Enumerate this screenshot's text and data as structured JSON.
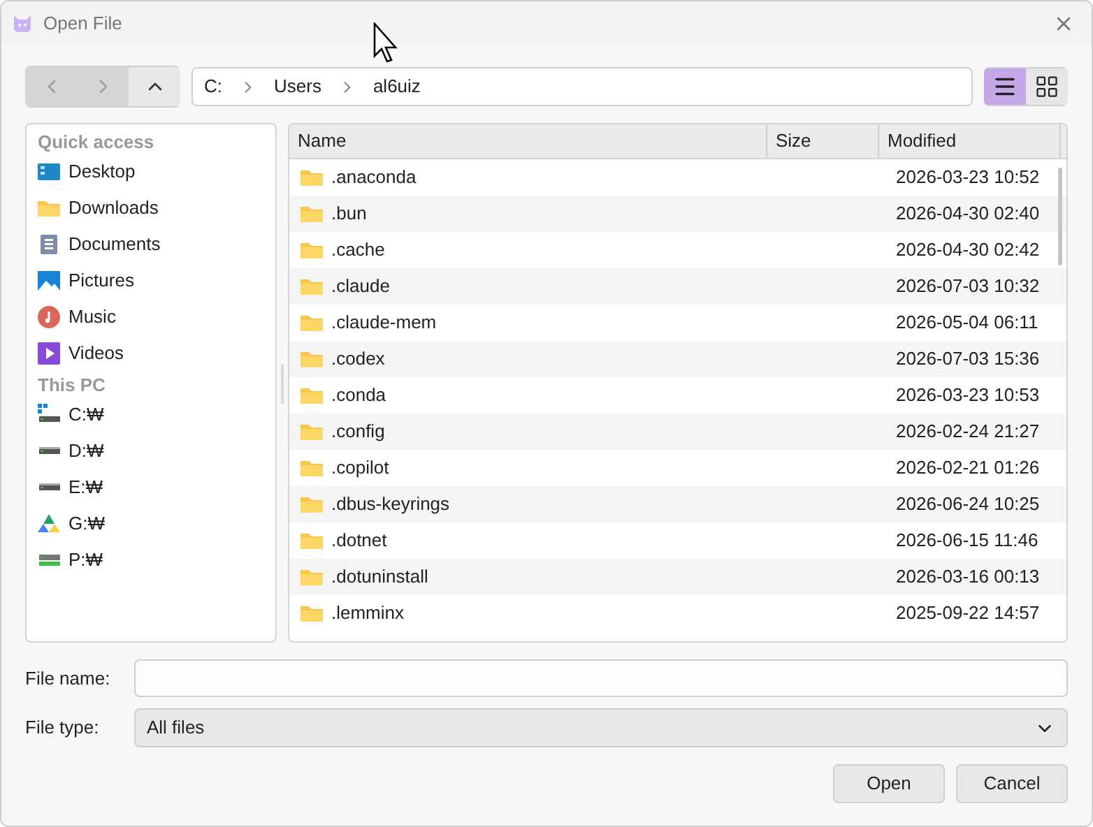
{
  "window": {
    "title": "Open File"
  },
  "nav": {
    "back": {
      "disabled": true
    },
    "forward": {
      "disabled": true
    },
    "up": {
      "disabled": false
    }
  },
  "breadcrumb": [
    "C:",
    "Users",
    "al6uiz"
  ],
  "view_buttons": [
    {
      "kind": "list",
      "selected": true
    },
    {
      "kind": "grid",
      "selected": false
    }
  ],
  "sidebar": {
    "sections": [
      {
        "title": "Quick access",
        "items": [
          {
            "label": "Desktop",
            "kind": "desktop"
          },
          {
            "label": "Downloads",
            "kind": "folder"
          },
          {
            "label": "Documents",
            "kind": "document"
          },
          {
            "label": "Pictures",
            "kind": "pictures"
          },
          {
            "label": "Music",
            "kind": "music"
          },
          {
            "label": "Videos",
            "kind": "videos"
          }
        ]
      },
      {
        "title": "This PC",
        "items": [
          {
            "label": "C:₩",
            "kind": "system-drive"
          },
          {
            "label": "D:₩",
            "kind": "drive"
          },
          {
            "label": "E:₩",
            "kind": "drive"
          },
          {
            "label": "G:₩",
            "kind": "cloud-drive"
          },
          {
            "label": "P:₩",
            "kind": "green-drive"
          }
        ]
      }
    ]
  },
  "table": {
    "columns": [
      "Name",
      "Size",
      "Modified"
    ],
    "rows": [
      {
        "name": ".anaconda",
        "size": "",
        "modified": "2026-03-23 10:52"
      },
      {
        "name": ".bun",
        "modified": "2026-04-30 02:40"
      },
      {
        "name": ".cache",
        "modified": "2026-04-30 02:42"
      },
      {
        "name": ".claude",
        "modified": "2026-07-03 10:32"
      },
      {
        "name": ".claude-mem",
        "modified": "2026-05-04 06:11"
      },
      {
        "name": ".codex",
        "modified": "2026-07-03 15:36"
      },
      {
        "name": ".conda",
        "modified": "2026-03-23 10:53"
      },
      {
        "name": ".config",
        "modified": "2026-02-24 21:27"
      },
      {
        "name": ".copilot",
        "modified": "2026-02-21 01:26"
      },
      {
        "name": ".dbus-keyrings",
        "modified": "2026-06-24 10:25"
      },
      {
        "name": ".dotnet",
        "modified": "2026-06-15 11:46"
      },
      {
        "name": ".dotuninstall",
        "modified": "2026-03-16 00:13"
      },
      {
        "name": ".lemminx",
        "modified": "2025-09-22 14:57"
      }
    ]
  },
  "file_name": {
    "label": "File name:"
  },
  "file_type": {
    "label": "File type:",
    "value": "All files"
  },
  "buttons": [
    "Open",
    "Cancel"
  ]
}
